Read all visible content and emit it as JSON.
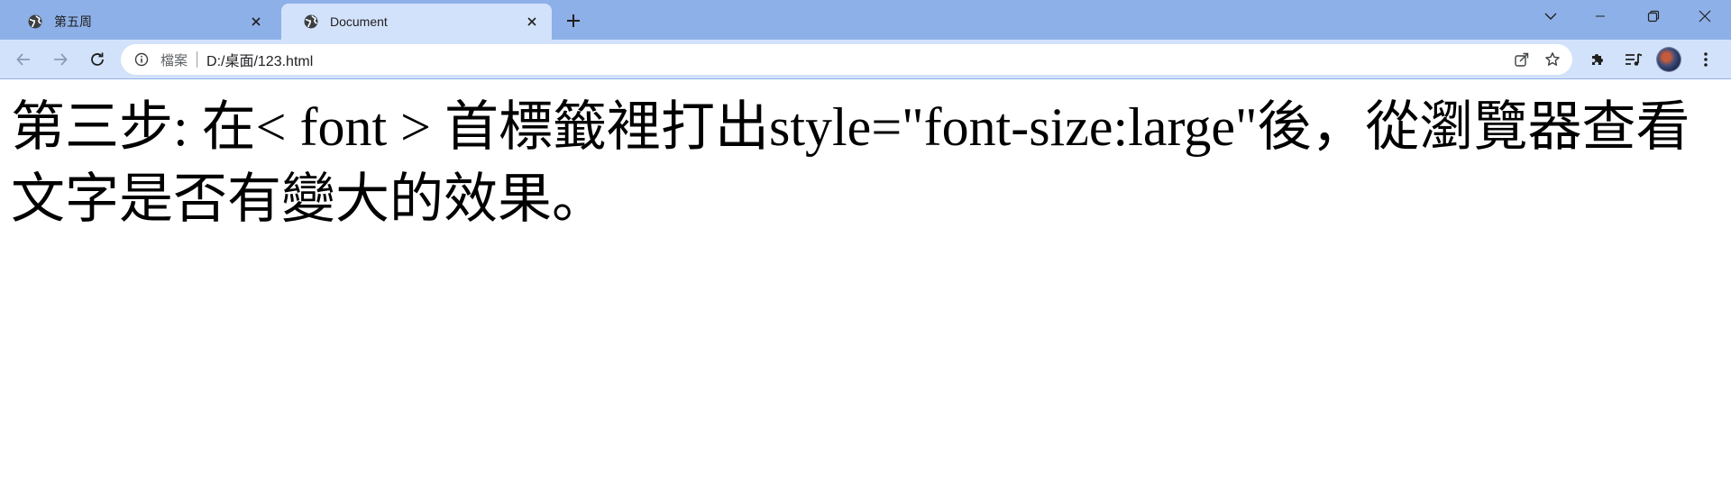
{
  "tabs": [
    {
      "title": "第五周",
      "icon": "globe-icon",
      "active": false
    },
    {
      "title": "Document",
      "icon": "globe-icon",
      "active": true
    }
  ],
  "toolbar": {
    "site_label": "檔案",
    "url": "D:/桌面/123.html"
  },
  "page": {
    "text": "第三步: 在< font > 首標籤裡打出style=\"font-size:large\"後，從瀏覽器查看文字是否有變大的效果。"
  },
  "colors": {
    "tabstrip": "#8eb0e8",
    "active_tab": "#d3e2fb",
    "toolbar": "#d3e2fb",
    "omnibox": "#ffffff",
    "page_bg": "#ffffff"
  }
}
